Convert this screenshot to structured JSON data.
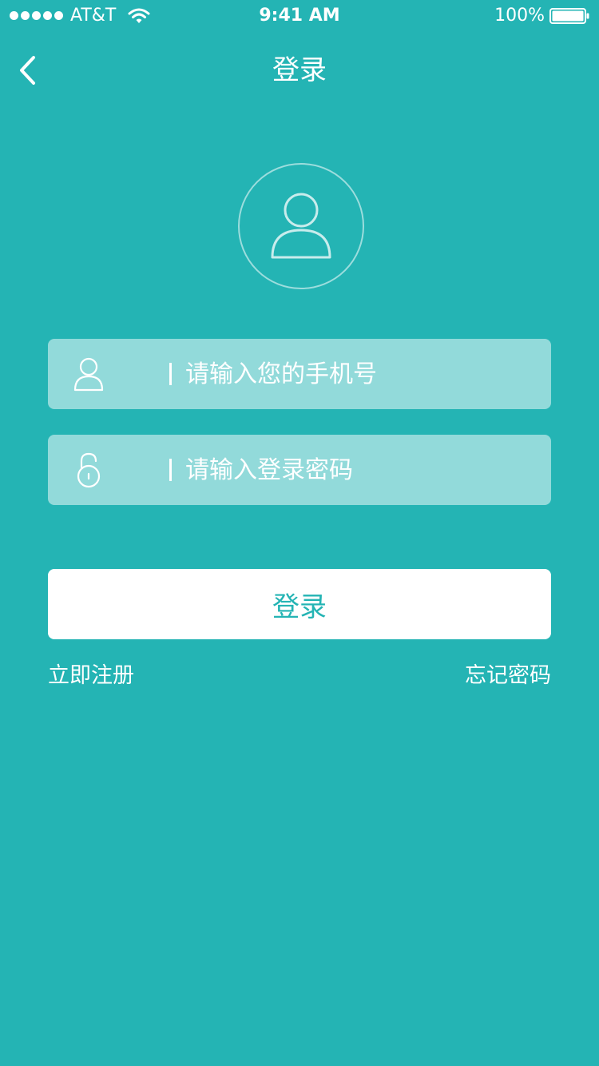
{
  "status_bar": {
    "carrier": "AT&T",
    "time": "9:41 AM",
    "battery_percent": "100%",
    "signal_icon": "signal-dots-icon",
    "wifi_icon": "wifi-icon",
    "battery_icon": "battery-icon",
    "battery_level": 1.0
  },
  "nav": {
    "title": "登录",
    "back_icon": "chevron-left-icon"
  },
  "avatar": {
    "icon": "user-avatar-icon"
  },
  "form": {
    "phone": {
      "placeholder": "请输入您的手机号",
      "value": "",
      "icon": "user-icon"
    },
    "password": {
      "placeholder": "请输入登录密码",
      "value": "",
      "icon": "lock-icon"
    }
  },
  "login_button": {
    "label": "登录"
  },
  "links": {
    "register": "立即注册",
    "forgot_password": "忘记密码"
  },
  "colors": {
    "background": "#24b4b4",
    "field_background": "#92dadd",
    "button_background": "#ffffff",
    "button_text": "#24b4b4",
    "text": "#ffffff"
  }
}
